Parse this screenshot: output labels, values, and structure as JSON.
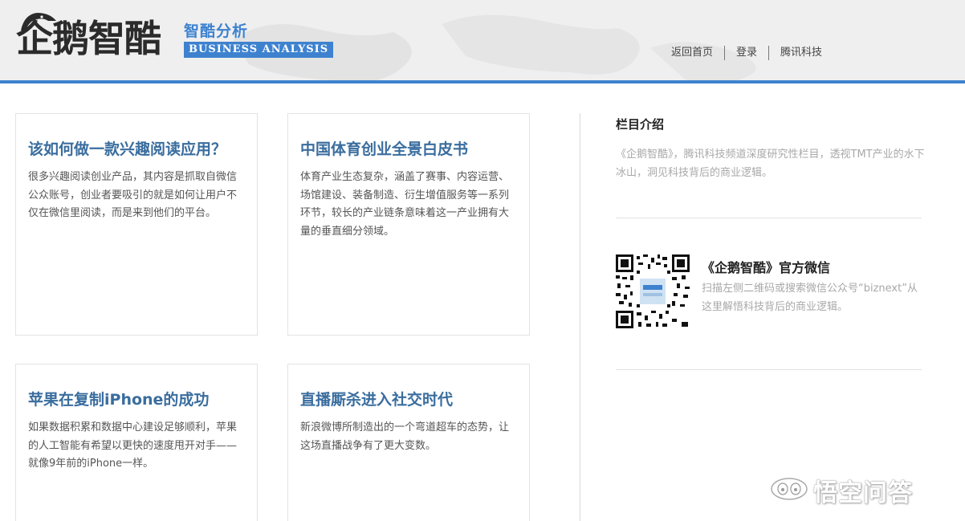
{
  "header": {
    "logo_text": "企鹅智酷",
    "subtitle_cn": "智酷分析",
    "subtitle_en": "BUSINESS ANALYSIS",
    "nav": [
      {
        "label": "返回首页"
      },
      {
        "label": "登录"
      },
      {
        "label": "腾讯科技"
      }
    ],
    "accent_color": "#3e82cf"
  },
  "cards": [
    {
      "title": "该如何做一款兴趣阅读应用？",
      "desc": "很多兴趣阅读创业产品，其内容是抓取自微信公众账号，创业者要吸引的就是如何让用户不仅在微信里阅读，而是来到他们的平台。"
    },
    {
      "title": "中国体育创业全景白皮书",
      "desc": "体育产业生态复杂，涵盖了赛事、内容运营、场馆建设、装备制造、衍生增值服务等一系列环节，较长的产业链条意味着这一产业拥有大量的垂直细分领域。"
    },
    {
      "title": "苹果在复制iPhone的成功",
      "desc": "如果数据积累和数据中心建设足够顺利，苹果的人工智能有希望以更快的速度甩开对手——就像9年前的iPhone一样。"
    },
    {
      "title": "直播厮杀进入社交时代",
      "desc": "新浪微博所制造出的一个弯道超车的态势，让这场直播战争有了更大变数。"
    }
  ],
  "sidebar": {
    "intro_title": "栏目介绍",
    "intro_desc": "《企鹅智酷》，腾讯科技频道深度研究性栏目，透视TMT产业的水下冰山，洞见科技背后的商业逻辑。",
    "wechat_title": "《企鹅智酷》官方微信",
    "wechat_desc": "扫描左侧二维码或搜索微信公众号“biznext”从这里解悟科技背后的商业逻辑。"
  },
  "watermark": {
    "text": "悟空问答"
  }
}
